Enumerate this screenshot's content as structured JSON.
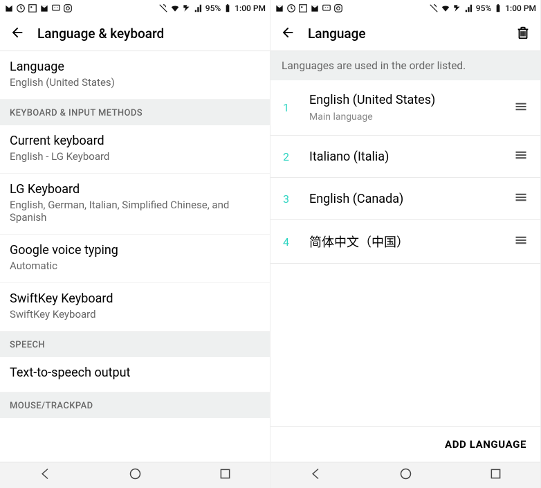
{
  "status": {
    "battery": "95%",
    "time": "1:00 PM"
  },
  "left": {
    "title": "Language & keyboard",
    "language_row": {
      "title": "Language",
      "sub": "English (United States)"
    },
    "section_keyboard": "KEYBOARD & INPUT METHODS",
    "rows": [
      {
        "title": "Current keyboard",
        "sub": "English - LG Keyboard"
      },
      {
        "title": "LG Keyboard",
        "sub": "English, German, Italian, Simplified Chinese, and Spanish"
      },
      {
        "title": "Google voice typing",
        "sub": "Automatic"
      },
      {
        "title": "SwiftKey Keyboard",
        "sub": "SwiftKey Keyboard"
      }
    ],
    "section_speech": "SPEECH",
    "tts_row": {
      "title": "Text-to-speech output"
    },
    "section_mouse": "MOUSE/TRACKPAD"
  },
  "right": {
    "title": "Language",
    "hint": "Languages are used in the order listed.",
    "items": [
      {
        "num": "1",
        "name": "English (United States)",
        "sub": "Main language"
      },
      {
        "num": "2",
        "name": "Italiano (Italia)"
      },
      {
        "num": "3",
        "name": "English (Canada)"
      },
      {
        "num": "4",
        "name": "简体中文（中国）"
      }
    ],
    "add_label": "ADD LANGUAGE"
  }
}
